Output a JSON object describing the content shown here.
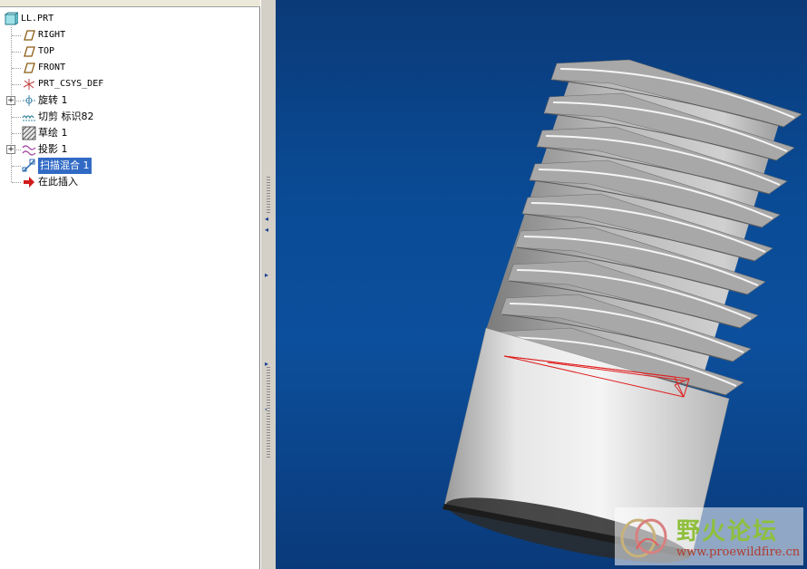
{
  "model_tree": {
    "root_label": "LL.PRT",
    "items": [
      {
        "label": "RIGHT",
        "icon": "datum-plane-icon",
        "expandable": false,
        "selected": false,
        "mono": true
      },
      {
        "label": "TOP",
        "icon": "datum-plane-icon",
        "expandable": false,
        "selected": false,
        "mono": true
      },
      {
        "label": "FRONT",
        "icon": "datum-plane-icon",
        "expandable": false,
        "selected": false,
        "mono": true
      },
      {
        "label": "PRT_CSYS_DEF",
        "icon": "coordinate-system-icon",
        "expandable": false,
        "selected": false,
        "mono": true
      },
      {
        "label": "旋转 1",
        "icon": "revolve-icon",
        "expandable": true,
        "selected": false,
        "mono": false
      },
      {
        "label": "切剪 标识82",
        "icon": "cut-icon",
        "expandable": false,
        "selected": false,
        "mono": false
      },
      {
        "label": "草绘 1",
        "icon": "sketch-icon",
        "expandable": false,
        "selected": false,
        "mono": false
      },
      {
        "label": "投影 1",
        "icon": "projection-icon",
        "expandable": true,
        "selected": false,
        "mono": false
      },
      {
        "label": "扫描混合 1",
        "icon": "swept-blend-icon",
        "expandable": false,
        "selected": true,
        "mono": false
      },
      {
        "label": "在此插入",
        "icon": "insert-here-arrow-icon",
        "expandable": false,
        "selected": false,
        "mono": false
      }
    ]
  },
  "watermark": {
    "title": "野火论坛",
    "url": "www.proewildfire.cn"
  },
  "colors": {
    "viewport_top": "#0b3a78",
    "viewport_bottom": "#0a3a7a",
    "selection": "#316ac5",
    "sketch_red": "#e02020",
    "model_gray": "#c8c8c8"
  }
}
